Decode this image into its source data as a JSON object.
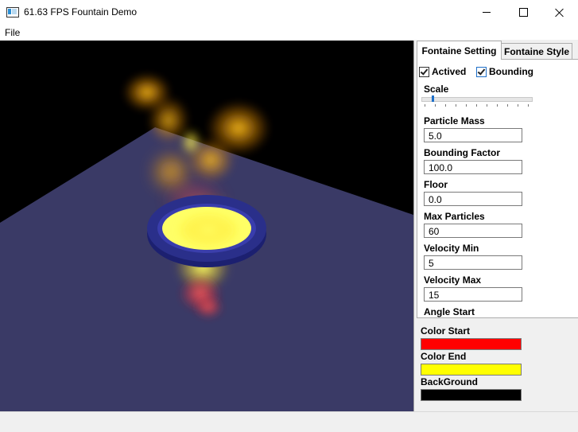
{
  "window": {
    "title": "61.63 FPS Fountain Demo"
  },
  "menu": {
    "items": [
      "File"
    ]
  },
  "panel": {
    "tabs": [
      {
        "label": "Fontaine Setting",
        "active": true
      },
      {
        "label": "Fontaine Style",
        "active": false
      }
    ],
    "checkboxes": [
      {
        "label": "Actived",
        "checked": true
      },
      {
        "label": "Bounding",
        "checked": true
      }
    ],
    "scale": {
      "label": "Scale",
      "value_fraction": 0.1
    },
    "fields": [
      {
        "label": "Particle Mass",
        "value": "5.0"
      },
      {
        "label": "Bounding Factor",
        "value": "100.0"
      },
      {
        "label": "Floor",
        "value": "0.0"
      },
      {
        "label": "Max Particles",
        "value": "60"
      },
      {
        "label": "Velocity Min",
        "value": "5"
      },
      {
        "label": "Velocity Max",
        "value": "15"
      },
      {
        "label": "Angle Start",
        "value": ""
      }
    ],
    "colors": [
      {
        "label": "Color Start",
        "color": "#ff0000"
      },
      {
        "label": "Color End",
        "color": "#ffff00"
      },
      {
        "label": "BackGround",
        "color": "#000000"
      }
    ]
  },
  "scene": {
    "background": "#000000",
    "floor_color": "#3a3a66",
    "ring_color": "#2a2f8a",
    "flame_colors": [
      "#ff2a2a",
      "#ffa500",
      "#ffff33"
    ]
  }
}
